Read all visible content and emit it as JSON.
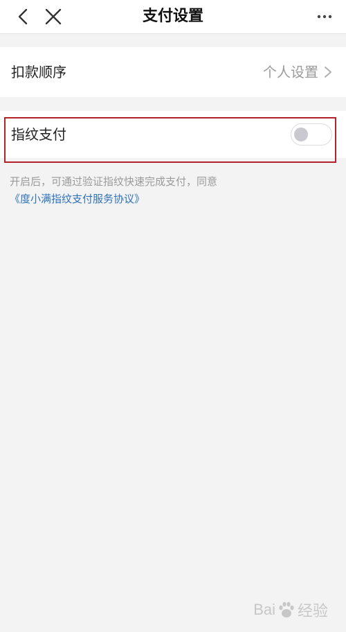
{
  "header": {
    "title": "支付设置",
    "back_icon": "chevron-left-icon",
    "close_icon": "close-icon",
    "more_icon": "more-horizontal-icon"
  },
  "settings": {
    "deduct_order": {
      "label": "扣款顺序",
      "value": "个人设置",
      "icon": "chevron-right-icon"
    },
    "fingerprint_pay": {
      "label": "指纹支付",
      "enabled": false
    }
  },
  "description": {
    "text": "开启后，可通过验证指纹快速完成支付，同意",
    "link": "《度小满指纹支付服务协议》"
  },
  "watermark": {
    "text_left": "Bai",
    "text_right": "经验"
  },
  "colors": {
    "highlight": "#b3222a",
    "link": "#2f72b8",
    "background": "#f3f3f3"
  }
}
